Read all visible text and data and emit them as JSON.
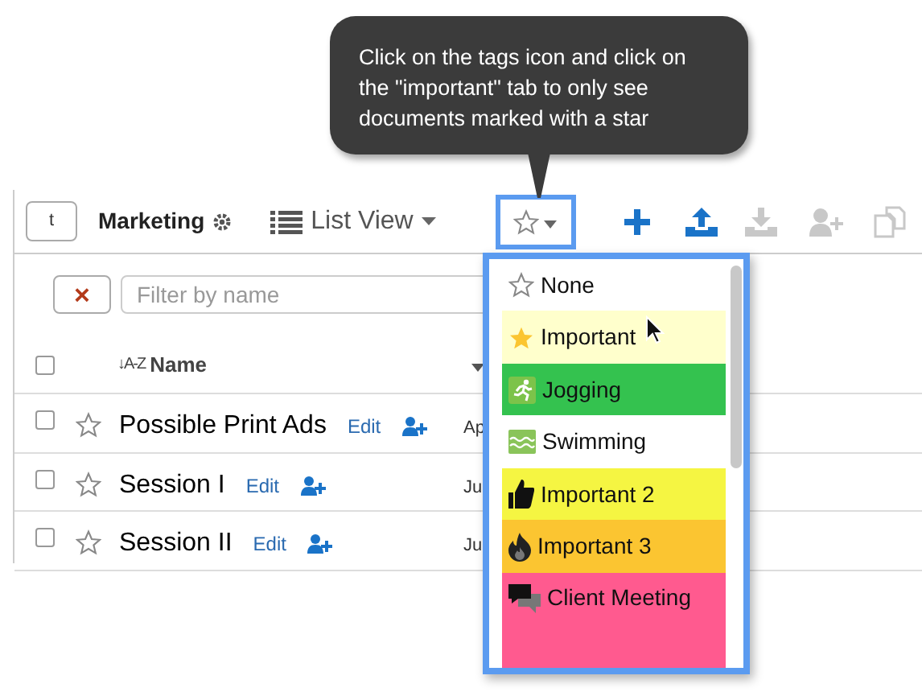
{
  "tooltip": {
    "text": "Click on the tags icon and click on the \"important\" tab to only see documents marked with a star"
  },
  "toolbar": {
    "home_button": "t",
    "folder": "Marketing",
    "view": "List View",
    "tools": [
      {
        "kind": "tags",
        "disabled": false
      },
      {
        "kind": "add",
        "disabled": false
      },
      {
        "kind": "upload",
        "disabled": false
      },
      {
        "kind": "download",
        "disabled": true
      },
      {
        "kind": "share",
        "disabled": true
      },
      {
        "kind": "copy",
        "disabled": true
      }
    ]
  },
  "filter": {
    "clear_button": "×",
    "placeholder": "Filter by name"
  },
  "table": {
    "select_all": {
      "checked": false
    },
    "columns": [
      {
        "label": "Name",
        "sort": "↓A-Z"
      }
    ],
    "rows": [
      {
        "checked": false,
        "starred": false,
        "name": "Possible Print Ads",
        "edit": "Edit",
        "column_3": "Ap"
      },
      {
        "checked": false,
        "starred": false,
        "name": "Session I",
        "edit": "Edit",
        "column_3": "Ju"
      },
      {
        "checked": false,
        "starred": false,
        "name": "Session II",
        "edit": "Edit",
        "column_3": "Ju"
      }
    ]
  },
  "tag_menu": {
    "items": [
      {
        "kind": "none",
        "label": "None",
        "color": "#ffffff"
      },
      {
        "kind": "star",
        "label": "Important",
        "color": "#ffffcc"
      },
      {
        "kind": "runner",
        "label": "Jogging",
        "color": "#34c24f"
      },
      {
        "kind": "waves",
        "label": "Swimming",
        "color": "#ffffff"
      },
      {
        "kind": "thumb",
        "label": "Important 2",
        "color": "#f5f542"
      },
      {
        "kind": "flame",
        "label": "Important 3",
        "color": "#fbc531"
      },
      {
        "kind": "chat",
        "label": "Client Meeting",
        "color": "#ff5a8f"
      }
    ]
  }
}
